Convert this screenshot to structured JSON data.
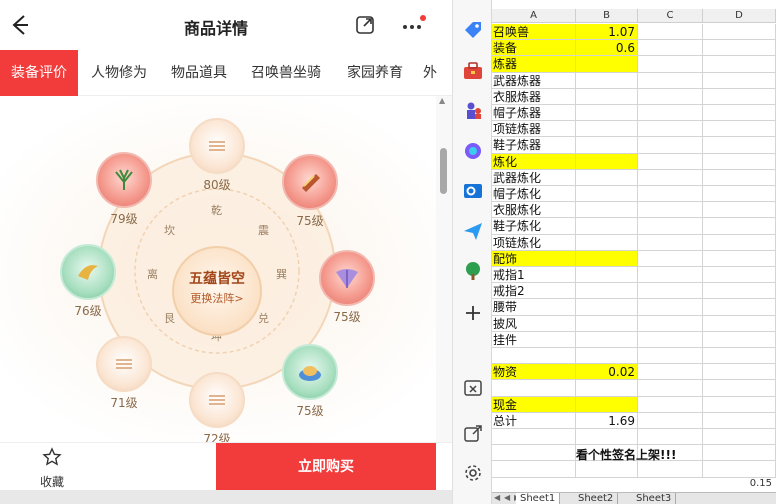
{
  "mobile": {
    "title": "商品详情",
    "tabs": [
      "装备评价",
      "人物修为",
      "物品道具",
      "召唤兽坐骑",
      "家园养育",
      "外"
    ],
    "active_tab_index": 0,
    "center": {
      "title": "五蕴皆空",
      "subtitle": "更换法阵>"
    },
    "trigrams": [
      "乾",
      "坤",
      "坎",
      "离",
      "震",
      "巽",
      "艮",
      "兑"
    ],
    "nodes": [
      {
        "level": "80级",
        "style": "plain"
      },
      {
        "level": "75级",
        "style": "red"
      },
      {
        "level": "75级",
        "style": "red"
      },
      {
        "level": "75级",
        "style": "green"
      },
      {
        "level": "72级",
        "style": "plain"
      },
      {
        "level": "71级",
        "style": "plain"
      },
      {
        "level": "76级",
        "style": "green"
      },
      {
        "level": "79级",
        "style": "red"
      }
    ],
    "bottom": {
      "favorite_label": "收藏",
      "buy_label": "立即购买"
    },
    "accent_color": "#f23b3b"
  },
  "sidebar": {
    "icons": [
      "tag-icon",
      "toolbox-icon",
      "chess-icon",
      "m365-icon",
      "outlook-icon",
      "send-icon",
      "tree-icon",
      "add-icon",
      "screenshot-icon",
      "external-link-icon",
      "settings-icon"
    ]
  },
  "sheet": {
    "columns": [
      "A",
      "B",
      "C",
      "D"
    ],
    "rows": [
      {
        "a": "召唤兽",
        "b": "1.07",
        "yellow": true
      },
      {
        "a": "装备",
        "b": "0.6",
        "yellow": true
      },
      {
        "a": "炼器",
        "b": "",
        "yellow": true
      },
      {
        "a": "武器炼器",
        "b": "",
        "yellow": false
      },
      {
        "a": "衣服炼器",
        "b": "",
        "yellow": false
      },
      {
        "a": "帽子炼器",
        "b": "",
        "yellow": false
      },
      {
        "a": "项链炼器",
        "b": "",
        "yellow": false
      },
      {
        "a": "鞋子炼器",
        "b": "",
        "yellow": false
      },
      {
        "a": "炼化",
        "b": "",
        "yellow": true
      },
      {
        "a": "武器炼化",
        "b": "",
        "yellow": false
      },
      {
        "a": "帽子炼化",
        "b": "",
        "yellow": false
      },
      {
        "a": "衣服炼化",
        "b": "",
        "yellow": false
      },
      {
        "a": "鞋子炼化",
        "b": "",
        "yellow": false
      },
      {
        "a": "项链炼化",
        "b": "",
        "yellow": false
      },
      {
        "a": "配饰",
        "b": "",
        "yellow": true
      },
      {
        "a": "戒指1",
        "b": "",
        "yellow": false
      },
      {
        "a": "戒指2",
        "b": "",
        "yellow": false
      },
      {
        "a": "腰带",
        "b": "",
        "yellow": false
      },
      {
        "a": "披风",
        "b": "",
        "yellow": false
      },
      {
        "a": "挂件",
        "b": "",
        "yellow": false
      },
      {
        "a": "",
        "b": "",
        "yellow": false
      },
      {
        "a": "物资",
        "b": "0.02",
        "yellow": true
      },
      {
        "a": "",
        "b": "",
        "yellow": false
      },
      {
        "a": "现金",
        "b": "",
        "yellow": true
      },
      {
        "a": "总计",
        "b": "1.69",
        "yellow": false
      },
      {
        "a": "",
        "b": "",
        "yellow": false
      },
      {
        "a": "",
        "b": "",
        "yellow": false
      },
      {
        "a": "",
        "b": "",
        "yellow": false
      }
    ],
    "banner_text": "看个性签名上架!!!",
    "status_value": "0.15",
    "sheet_tabs": [
      "Sheet1",
      "Sheet2",
      "Sheet3"
    ],
    "highlight_color": "#ffff00"
  }
}
